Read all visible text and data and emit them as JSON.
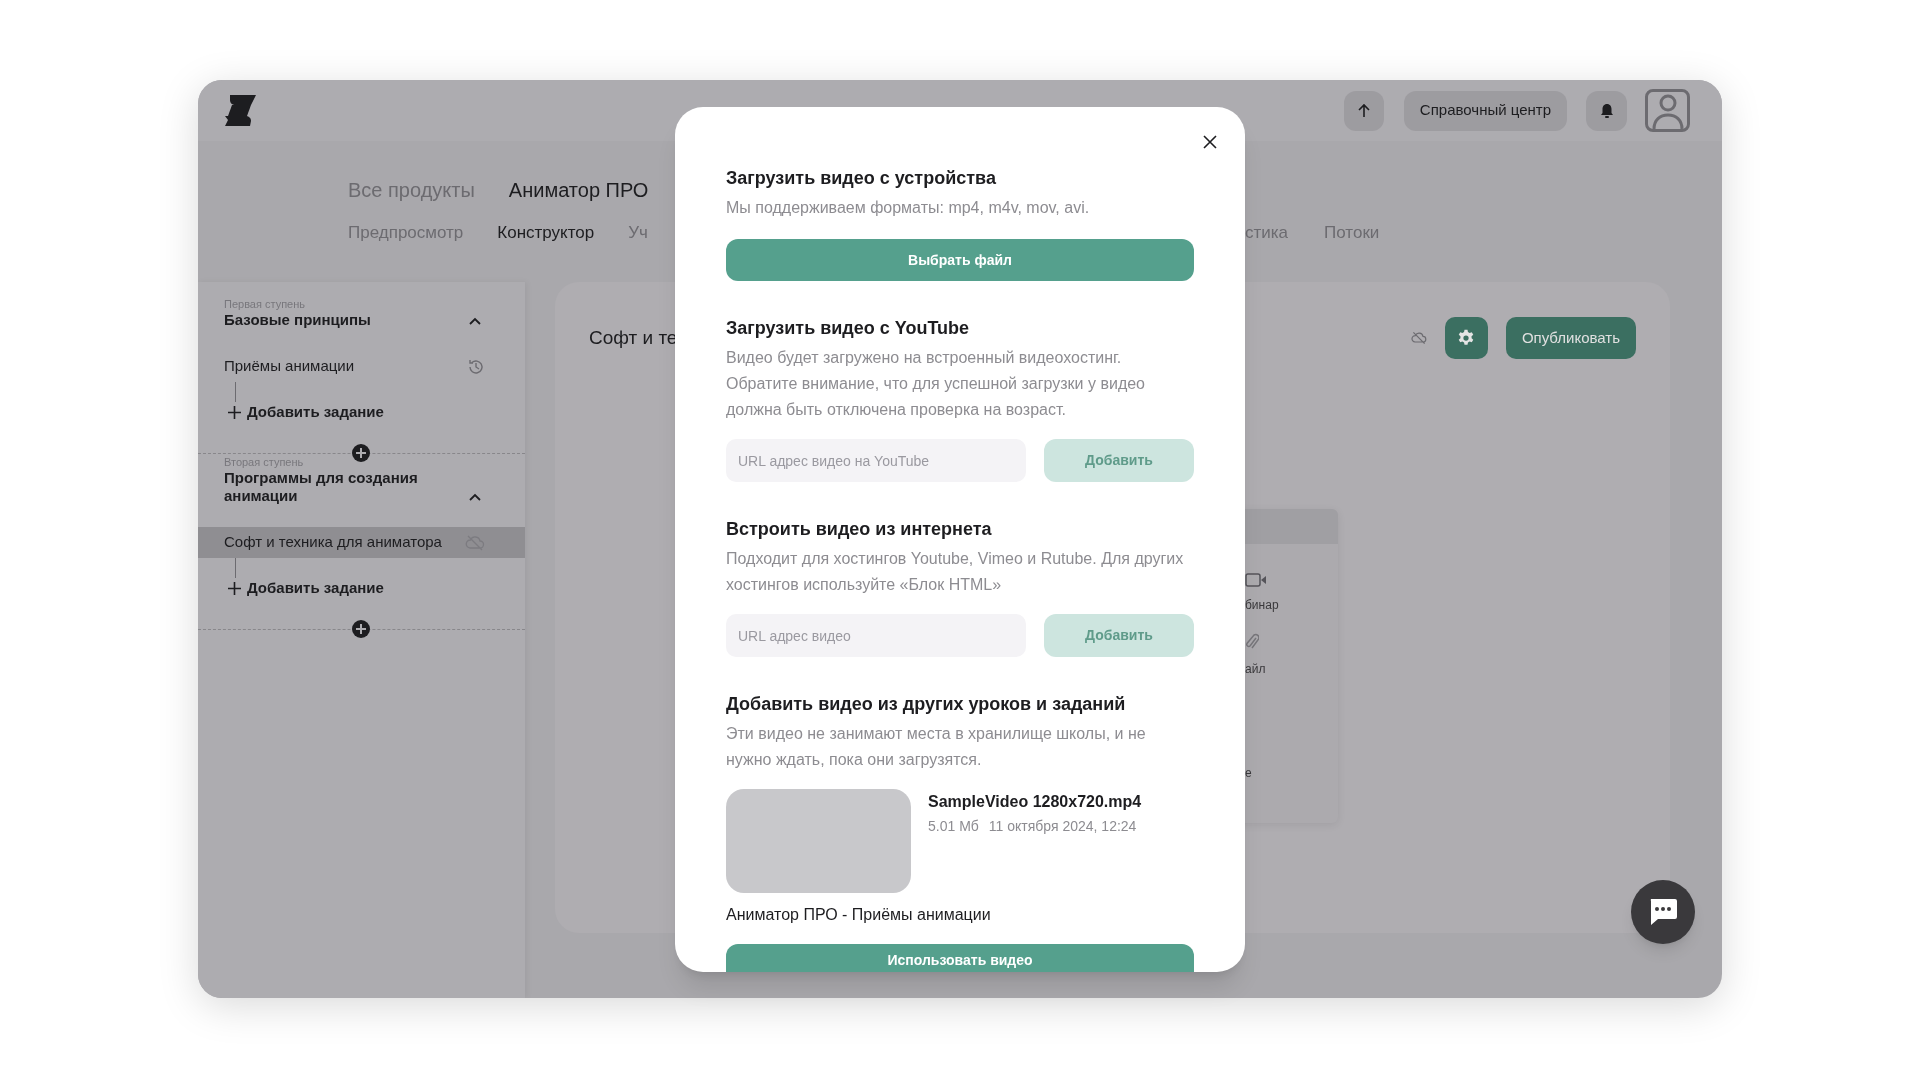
{
  "header": {
    "help_button": "Справочный центр"
  },
  "nav": {
    "primary": [
      {
        "label": "Все продукты",
        "selected": false
      },
      {
        "label": "Аниматор ПРО",
        "selected": true
      }
    ],
    "secondary_left": [
      {
        "label": "Предпросмотр",
        "selected": false
      },
      {
        "label": "Конструктор",
        "selected": true
      },
      {
        "label": "Уч",
        "selected": false
      }
    ],
    "secondary_right": [
      {
        "label": "стика",
        "selected": false
      },
      {
        "label": "Потоки",
        "selected": false
      }
    ]
  },
  "sidebar": {
    "stages": [
      {
        "caption": "Первая ступень",
        "title": "Базовые принципы",
        "expanded": true,
        "lessons": [
          {
            "title": "Приёмы анимации",
            "kind": "history",
            "selected": false
          }
        ],
        "add_label": "Добавить задание"
      },
      {
        "caption": "Вторая ступень",
        "title": "Программы для создания анимации",
        "expanded": true,
        "lessons": [
          {
            "title": "Софт и техника для аниматора",
            "kind": "unpublished",
            "selected": true
          }
        ],
        "add_label": "Добавить задание"
      }
    ]
  },
  "lesson": {
    "title": "Софт и те",
    "publish_button": "Опубликовать",
    "block_menu": [
      {
        "kind": "webinar",
        "label": "бинар"
      },
      {
        "kind": "file",
        "label": "айл"
      },
      {
        "kind": "other",
        "label": "е"
      }
    ]
  },
  "modal": {
    "sections": [
      {
        "kind": "upload",
        "title": "Загрузить видео с устройства",
        "description": "Мы поддерживаем форматы: mp4, m4v, mov, avi.",
        "button": "Выбрать файл"
      },
      {
        "kind": "url",
        "title": "Загрузить видео с YouTube",
        "description": "Видео будет загружено на встроенный видеохостинг. Обратите внимание, что для успешной загрузки у видео должна быть отключена проверка на возраст.",
        "placeholder": "URL адрес видео на YouTube",
        "button": "Добавить",
        "disabled": true
      },
      {
        "kind": "url",
        "title": "Встроить видео из интернета",
        "description": "Подходит для хостингов Youtube, Vimeo и Rutube. Для других хостингов используйте «Блок HTML»",
        "placeholder": "URL адрес видео",
        "button": "Добавить",
        "disabled": true
      },
      {
        "kind": "library",
        "title": "Добавить видео из других уроков и заданий",
        "description": "Эти видео не занимают места в хранилище школы, и не нужно ждать, пока они загрузятся.",
        "videos": [
          {
            "name": "SampleVideo 1280x720.mp4",
            "size": "5.01 Мб",
            "date": "11 октября 2024, 12:24",
            "lesson": "Аниматор ПРО - Приёмы анимации"
          }
        ],
        "button": "Использовать видео"
      }
    ]
  }
}
